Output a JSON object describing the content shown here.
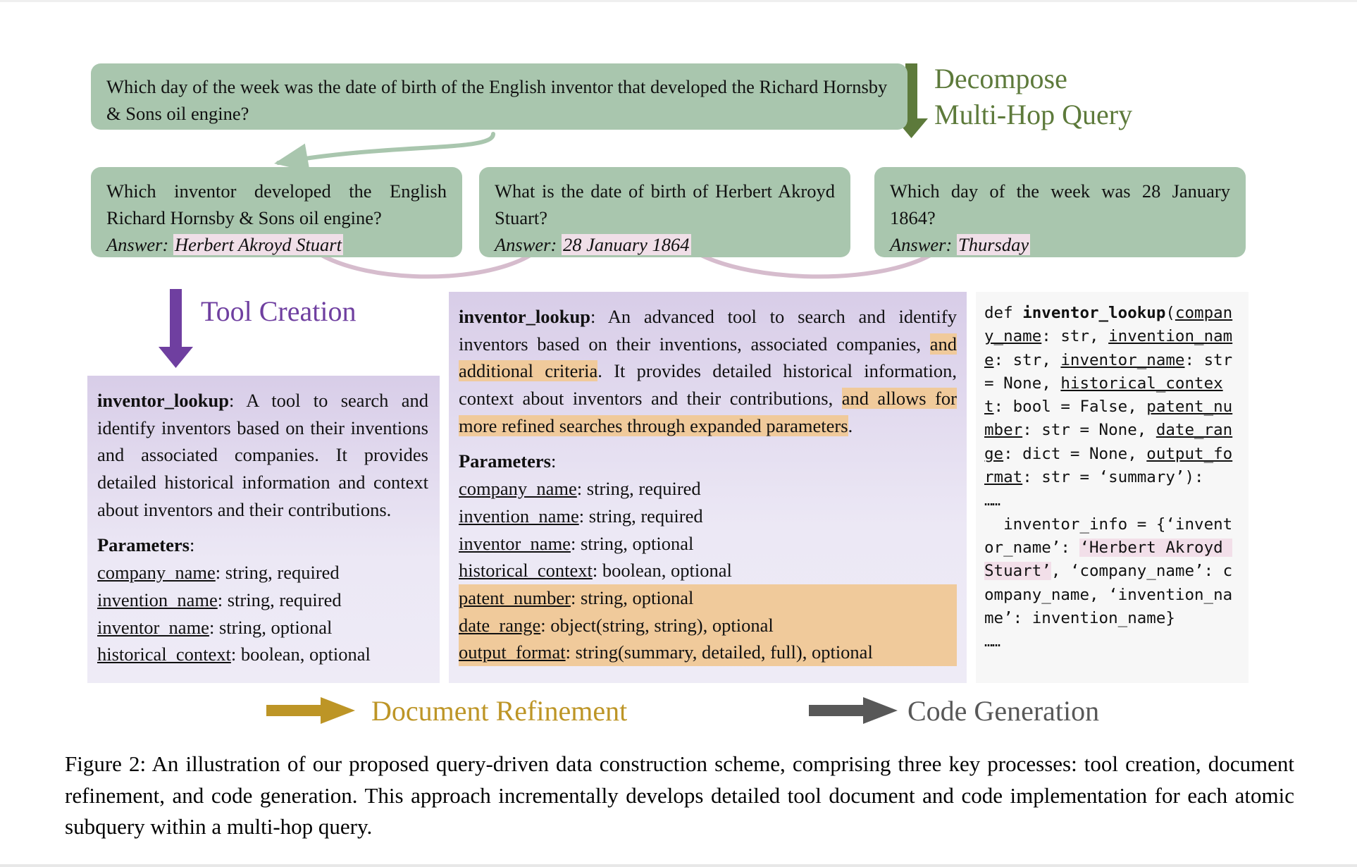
{
  "figure": {
    "root_query": "Which day of the week was the date of birth of the English inventor that developed the Richard Hornsby & Sons oil engine?",
    "labels": {
      "decompose": "Decompose\nMulti-Hop Query",
      "tool_creation": "Tool Creation",
      "document_refinement": "Document Refinement",
      "code_generation": "Code Generation"
    },
    "colors": {
      "green_box": "#a9c6ae",
      "green_text": "#5d7a3b",
      "lavender_panel_top": "#d8cde8",
      "lavender_panel_bottom": "#eeebf6",
      "purple_arrow": "#6f3fa0",
      "pink_highlight": "#f0dfe8",
      "orange_highlight": "#f0ca9b",
      "gold_arrow": "#bd9526",
      "gray_arrow": "#585858",
      "pink_connector": "#d6bccd",
      "code_background": "#f7f7f7"
    },
    "subqueries": [
      {
        "question": "Which inventor developed the English Richard Hornsby & Sons oil engine?",
        "answer_label": "Answer:",
        "answer_value": "Herbert Akroyd Stuart"
      },
      {
        "question": "What is the date of birth of Herbert Akroyd Stuart?",
        "answer_label": "Answer:",
        "answer_value": "28 January 1864"
      },
      {
        "question": "Which day of the week was 28 January 1864?",
        "answer_label": "Answer:",
        "answer_value": "Thursday"
      }
    ],
    "doc_basic": {
      "tool_name": "inventor_lookup",
      "description": ": A tool to search and identify inventors based on their inventions and associated companies. It provides detailed historical information and context about inventors and their contributions.",
      "parameters_heading": "Parameters",
      "parameters_heading_colon": ":",
      "parameters": [
        {
          "key": "company_name",
          "value": ": string, required"
        },
        {
          "key": "invention_name",
          "value": ": string, required"
        },
        {
          "key": "inventor_name",
          "value": ": string, optional"
        },
        {
          "key": "historical_context",
          "value": ": boolean, optional"
        }
      ]
    },
    "doc_refined": {
      "tool_name": "inventor_lookup",
      "desc_part_1": ": An advanced tool to search and identify inventors based on their inventions, associated companies, ",
      "desc_hl_1": "and additional criteria",
      "desc_part_2": ". It provides detailed historical information, context about inventors and their contributions, ",
      "desc_hl_2": "and allows for more refined searches through expanded parameters",
      "desc_part_3": ".",
      "parameters_heading": "Parameters",
      "parameters_heading_colon": ":",
      "parameters": [
        {
          "key": "company_name",
          "value": ": string, required",
          "highlight": false
        },
        {
          "key": "invention_name",
          "value": ": string, required",
          "highlight": false
        },
        {
          "key": "inventor_name",
          "value": ": string, optional",
          "highlight": false
        },
        {
          "key": "historical_context",
          "value": ": boolean, optional",
          "highlight": false
        },
        {
          "key": "patent_number",
          "value": ": string, optional",
          "highlight": true
        },
        {
          "key": "date_range",
          "value": ": object(string, string), optional",
          "highlight": true
        },
        {
          "key": "output_format",
          "value": ": string(summary, detailed, full), optional",
          "highlight": true
        }
      ]
    },
    "code": {
      "def_kw": "def ",
      "func_name": "inventor_lookup",
      "open_paren": "(",
      "signature_params": [
        {
          "name": "company_name",
          "rest": ": str, "
        },
        {
          "name": "invention_name",
          "rest": ": str, "
        },
        {
          "name": "inventor_name",
          "rest": ": str = None, "
        },
        {
          "name": "historical_context",
          "rest": ": bool = False, "
        },
        {
          "name": "patent_number",
          "rest": ": str = None, "
        },
        {
          "name": "date_range",
          "rest": ": dict = None, "
        },
        {
          "name": "output_format",
          "rest": ": str = ‘summary’):"
        }
      ],
      "ellipsis_1": "……",
      "body_part_1": "  inventor_info = {‘inventor_name’: ",
      "body_hl": "‘Herbert Akroyd Stuart’",
      "body_part_2": ", ‘company_name’: company_name, ‘invention_name’: invention_name}",
      "ellipsis_2": "……"
    },
    "caption": "Figure 2: An illustration of our proposed query-driven data construction scheme, comprising three key processes: tool creation, document refinement, and code generation. This approach incrementally develops detailed tool document and code implementation for each atomic subquery within a multi-hop query."
  }
}
